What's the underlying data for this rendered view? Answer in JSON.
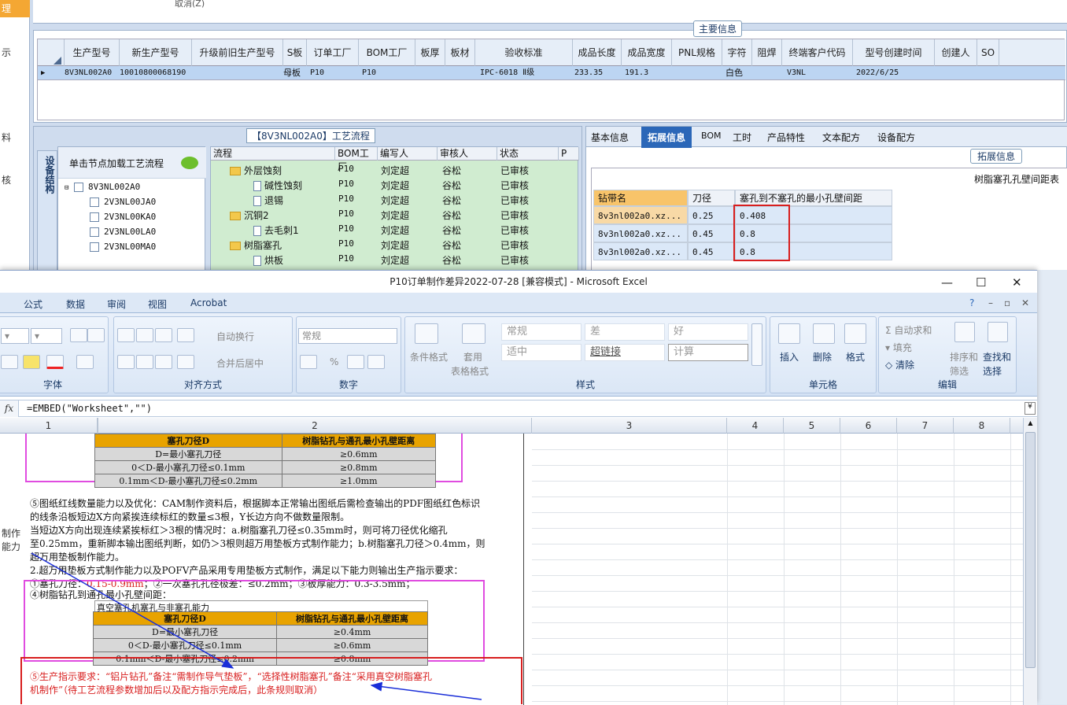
{
  "erp": {
    "left_labels": [
      "理",
      "示",
      "料",
      "核",
      "制作",
      "能力"
    ],
    "cancel_label": "取消(Z)",
    "main_info_title": "主要信息",
    "grid": {
      "columns": [
        "生产型号",
        "新生产型号",
        "升级前旧生产型号",
        "S板",
        "订单工厂",
        "BOM工厂",
        "板厚",
        "板材",
        "验收标准",
        "成品长度",
        "成品宽度",
        "PNL规格",
        "字符",
        "阻焊",
        "终端客户代码",
        "型号创建时间",
        "创建人",
        "SO"
      ],
      "row": [
        "8V3NL002A0",
        "10010800068190",
        "",
        "母板",
        "P10",
        "P10",
        "",
        "",
        "IPC-6018 Ⅱ级",
        "233.35",
        "191.3",
        "",
        "白色",
        "",
        "V3NL",
        "2022/6/25",
        "",
        ""
      ]
    },
    "process_title": "【8V3NL002A0】工艺流程",
    "vertical_tab": "设备结构",
    "node_hint": "单击节点加载工艺流程",
    "tree_nodes": [
      "8V3NL002A0",
      "2V3NL00JA0",
      "2V3NL00KA0",
      "2V3NL00LA0",
      "2V3NL00MA0"
    ],
    "process_columns": [
      "流程",
      "BOM工厂",
      "编写人",
      "审核人",
      "状态",
      "P"
    ],
    "process_rows": [
      {
        "name": "外层蚀刻",
        "factory": "P10",
        "writer": "刘定超",
        "reviewer": "谷松",
        "status": "已审核",
        "folder": true
      },
      {
        "name": "碱性蚀刻",
        "factory": "P10",
        "writer": "刘定超",
        "reviewer": "谷松",
        "status": "已审核",
        "folder": false
      },
      {
        "name": "退锡",
        "factory": "P10",
        "writer": "刘定超",
        "reviewer": "谷松",
        "status": "已审核",
        "folder": false
      },
      {
        "name": "沉铜2",
        "factory": "P10",
        "writer": "刘定超",
        "reviewer": "谷松",
        "status": "已审核",
        "folder": true
      },
      {
        "name": "去毛刺1",
        "factory": "P10",
        "writer": "刘定超",
        "reviewer": "谷松",
        "status": "已审核",
        "folder": false
      },
      {
        "name": "树脂塞孔",
        "factory": "P10",
        "writer": "刘定超",
        "reviewer": "谷松",
        "status": "已审核",
        "folder": true
      },
      {
        "name": "烘板",
        "factory": "P10",
        "writer": "刘定超",
        "reviewer": "谷松",
        "status": "已审核",
        "folder": false
      }
    ],
    "right_tabs": [
      "基本信息",
      "拓展信息",
      "BOM",
      "工时",
      "产品特性",
      "文本配方",
      "设备配方"
    ],
    "ext_title": "拓展信息",
    "ext_caption": "树脂塞孔孔壁间距表",
    "ext_columns": [
      "钻带名",
      "刀径",
      "塞孔到不塞孔的最小孔壁间距"
    ],
    "ext_rows": [
      [
        "8v3nl002a0.xz...",
        "0.25",
        "0.408"
      ],
      [
        "8v3nl002a0.xz...",
        "0.45",
        "0.8"
      ],
      [
        "8v3nl002a0.xz...",
        "0.45",
        "0.8"
      ]
    ]
  },
  "excel": {
    "title": "P10订单制作差异2022-07-28  [兼容模式] - Microsoft Excel",
    "tabs": [
      "公式",
      "数据",
      "审阅",
      "视图",
      "Acrobat"
    ],
    "groups": {
      "font": "字体",
      "align": "对齐方式",
      "number": "数字",
      "styles": "样式",
      "cells": "单元格",
      "edit": "编辑"
    },
    "buttons": {
      "wrap": "自动换行",
      "merge": "合并后居中",
      "number_format": "常规",
      "cond_format": "条件格式",
      "table_format_1": "套用",
      "table_format_2": "表格格式",
      "insert": "插入",
      "delete": "删除",
      "format": "格式",
      "autosum": "自动求和",
      "fill": "填充",
      "clear": "清除",
      "sort_1": "排序和",
      "sort_2": "筛选",
      "find_1": "查找和",
      "find_2": "选择"
    },
    "styles": [
      "常规",
      "差",
      "好",
      "适中",
      "超链接",
      "计算"
    ],
    "formula": "=EMBED(\"Worksheet\",\"\")",
    "columns": [
      "1",
      "2",
      "3",
      "4",
      "5",
      "6",
      "7",
      "8"
    ],
    "doc": {
      "table1_header": [
        "塞孔刀径D",
        "树脂钻孔与通孔最小孔壁距离"
      ],
      "table1_rows": [
        [
          "D=最小塞孔刀径",
          "≥0.6mm"
        ],
        [
          "0＜D-最小塞孔刀径≤0.1mm",
          "≥0.8mm"
        ],
        [
          "0.1mm＜D-最小塞孔刀径≤0.2mm",
          "≥1.0mm"
        ]
      ],
      "p1": "⑤图纸红线数量能力以及优化：CAM制作资料后，根据脚本正常输出图纸后需检查输出的PDF图纸红色标识",
      "p2": "的线条沿板短边X方向紧挨连续标红的数量≤3根，Y长边方向不做数量限制。",
      "p3": "当短边X方向出现连续紧挨标红＞3根的情况时：a.树脂塞孔刀径≤0.35mm时，则可将刀径优化缩孔",
      "p4": "至0.25mm，重新脚本输出图纸判断，如仍＞3根则超万用垫板方式制作能力；b.树脂塞孔刀径＞0.4mm，则",
      "p5": "超万用垫板制作能力。",
      "p6": "2.超万用垫板方式制作能力以及POFV产品采用专用垫板方式制作，满足以下能力则输出生产指示要求：",
      "p7a": "①塞孔刀径：",
      "p7b": "0.15-0.9mm",
      "p7c": "；②一次塞孔孔径极差：≤0.2mm；③板厚能力：0.3-3.5mm；",
      "p8": "④树脂钻孔到通孔最小孔壁间距：",
      "table2_caption": "真空塞孔机塞孔与非塞孔能力",
      "table2_header": [
        "塞孔刀径D",
        "树脂钻孔与通孔最小孔壁距离"
      ],
      "table2_rows": [
        [
          "D=最小塞孔刀径",
          "≥0.4mm"
        ],
        [
          "0＜D-最小塞孔刀径≤0.1mm",
          "≥0.6mm"
        ],
        [
          "0.1mm＜D-最小塞孔刀径≤0.2mm",
          "≥0.8mm"
        ]
      ],
      "red1": "⑤生产指示要求：“铝片钻孔”备注“需制作导气垫板”，“选择性树脂塞孔”备注“采用真空树脂塞孔",
      "red2": "机制作”（待工艺流程参数增加后以及配方指示完成后，此条规则取消）"
    }
  }
}
